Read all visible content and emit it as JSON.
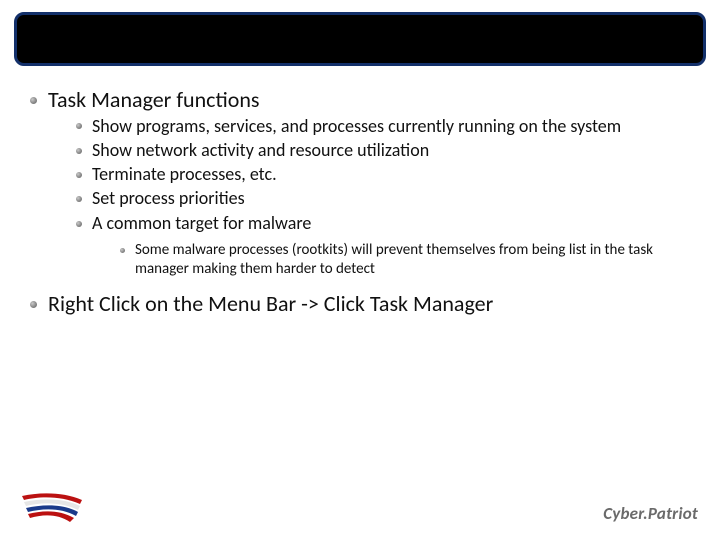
{
  "content": {
    "sections": [
      {
        "text": "Task Manager functions",
        "children": [
          {
            "text": "Show programs, services, and processes currently running on the system"
          },
          {
            "text": "Show network activity and resource utilization"
          },
          {
            "text": "Terminate processes, etc."
          },
          {
            "text": "Set process priorities"
          },
          {
            "text": "A common target for malware",
            "children": [
              {
                "text": "Some malware processes (rootkits) will prevent themselves from being list in the task manager making them harder to detect"
              }
            ]
          }
        ]
      },
      {
        "text": "Right Click on the Menu Bar -> Click Task Manager"
      }
    ]
  },
  "footer": {
    "brand": "Cyber.Patriot"
  }
}
